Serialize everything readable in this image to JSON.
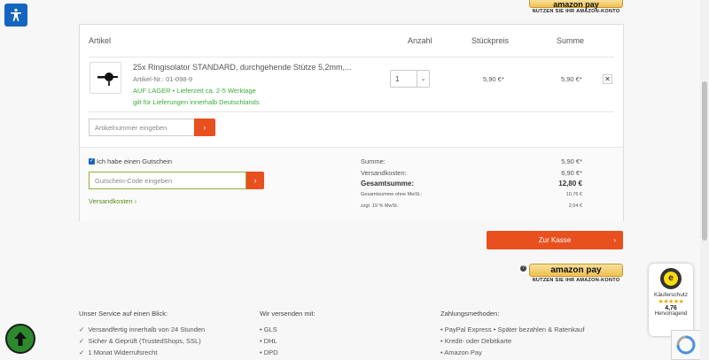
{
  "amazon": {
    "label": "amazon pay",
    "caption": "NUTZEN SIE IHR AMAZON-KONTO"
  },
  "cart": {
    "headers": {
      "article": "Artikel",
      "qty": "Anzahl",
      "unit_price": "Stückpreis",
      "sum": "Summe"
    },
    "item": {
      "name": "25x Ringisolator STANDARD, durchgehende Stütze 5,2mm,...",
      "article_nr": "Artikel-Nr.: 01-098-9",
      "stock": "AUF LAGER • Lieferzeit ca. 2-5 Werktage",
      "shipping_note": "gilt für Lieferungen innerhalb Deutschlands",
      "quantity": "1",
      "unit_price": "5,90 €*",
      "sum": "5,90 €*"
    },
    "article_input_placeholder": "Artikelnummer eingeben",
    "voucher_label": "Ich habe einen Gutschein",
    "voucher_placeholder": "Gutschein-Code eingeben",
    "shipping_costs_link": "Versandkosten",
    "totals": [
      {
        "label": "Summe:",
        "value": "5,90 €*"
      },
      {
        "label": "Versandkosten:",
        "value": "6,90 €*"
      },
      {
        "label": "Gesamtsumme:",
        "value": "12,80 €"
      },
      {
        "label": "Gesamtsumme ohne MwSt.:",
        "value": "10,76 €"
      },
      {
        "label": "zzgl. 19 % MwSt.:",
        "value": "2,04 €"
      }
    ]
  },
  "checkout": {
    "label": "Zur Kasse"
  },
  "footer": {
    "service": {
      "title": "Unser Service auf einen Blick:",
      "items": [
        "Versandfertig innerhalb von 24 Stunden",
        "Sicher & Geprüft (TrustedShops, SSL)",
        "1 Monat Widerrufsrecht"
      ]
    },
    "shipping": {
      "title": "Wir versenden mit:",
      "items": [
        "• GLS",
        "• DHL",
        "• DPD"
      ]
    },
    "payment": {
      "title": "Zahlungsmethoden:",
      "items": [
        "• PayPal Express • Später bezahlen & Ratenkauf",
        "• Kredit- oder Debitkarte",
        "• Amazon Pay"
      ]
    }
  },
  "trusted": {
    "title": "Käuferschutz",
    "stars": "★★★★★",
    "rating": "4,76",
    "grade": "Hervorragend",
    "logo": "e"
  },
  "colors": {
    "accent": "#e8501e",
    "green": "#3cab3c",
    "amazon": "#f0c14b"
  }
}
